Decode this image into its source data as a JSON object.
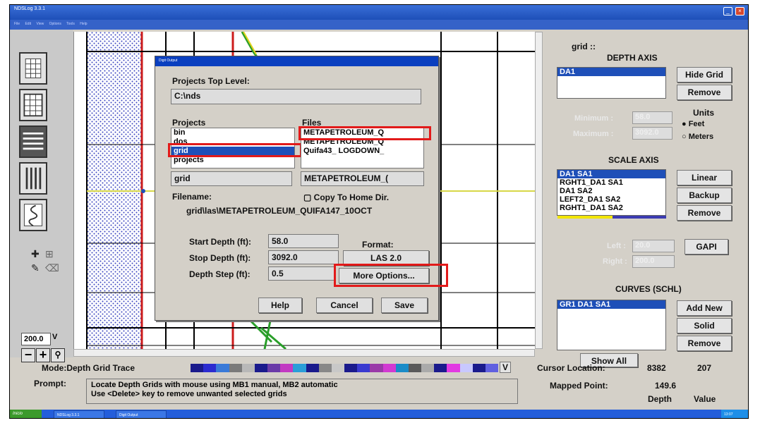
{
  "window": {
    "title": "NDSLog 3.3.1",
    "menu": [
      "File",
      "Edit",
      "View",
      "Options",
      "Tools",
      "Help"
    ]
  },
  "toolbar": {
    "zoom_value": "200.0",
    "zoom_dropdown": "V"
  },
  "dialog": {
    "title": "Digit Output",
    "projects_top_label": "Projects Top Level:",
    "projects_top_value": "C:\\nds",
    "projects_label": "Projects",
    "files_label": "Files",
    "projects_list": [
      "bin",
      "dos",
      "grid",
      "projects"
    ],
    "projects_selected": "grid",
    "files_list": [
      "METAPETROLEUM_Q",
      "METAPETROLEUM_Q",
      "Quifa43_ LOGDOWN_"
    ],
    "project_field": "grid",
    "file_field": "METAPETROLEUM_(",
    "filename_label": "Filename:",
    "copy_home": "Copy To Home Dir.",
    "filename_value": "grid\\las\\METAPETROLEUM_QUIFA147_10OCT",
    "start_depth_label": "Start Depth (ft):",
    "start_depth_value": "58.0",
    "stop_depth_label": "Stop Depth (ft):",
    "stop_depth_value": "3092.0",
    "depth_step_label": "Depth Step (ft):",
    "depth_step_value": "0.5",
    "format_label": "Format:",
    "format_value": "LAS 2.0",
    "more_options": "More Options...",
    "help": "Help",
    "cancel": "Cancel",
    "save": "Save"
  },
  "right_panel": {
    "grid_label": "grid ::",
    "depth_axis_title": "DEPTH AXIS",
    "depth_axis_items": [
      "DA1"
    ],
    "hide_grid": "Hide Grid",
    "remove1": "Remove",
    "units_label": "Units",
    "unit_feet": "Feet",
    "unit_meters": "Meters",
    "minimum_label": "Minimum :",
    "minimum_value": "58.0",
    "maximum_label": "Maximum :",
    "maximum_value": "3092.0",
    "scale_axis_title": "SCALE AXIS",
    "scale_axis_items": [
      "DA1 SA1",
      "RGHT1_DA1 SA1",
      "DA1 SA2",
      "LEFT2_DA1 SA2",
      "RGHT1_DA1 SA2"
    ],
    "linear": "Linear",
    "backup": "Backup",
    "remove2": "Remove",
    "left_label": "Left :",
    "left_value": "20.0",
    "right_label": "Right :",
    "right_value": "200.0",
    "gapi": "GAPI",
    "curves_title": "CURVES (SCHL)",
    "curves_items": [
      "GR1 DA1 SA1"
    ],
    "add_new": "Add New",
    "solid": "Solid",
    "remove3": "Remove",
    "show_all": "Show All"
  },
  "status": {
    "mode": "Mode:Depth Grid Trace",
    "colorbar_dropdown": "V",
    "prompt_label": "Prompt:",
    "prompt_line1": "Locate Depth Grids with mouse using MB1 manual, MB2 automatic",
    "prompt_line2": "Use <Delete> key to remove unwanted selected grids",
    "cursor_label": "Cursor Location:",
    "cursor_x": "8382",
    "cursor_y": "207",
    "mapped_label": "Mapped Point:",
    "mapped_value": "149.6",
    "depth_label": "Depth",
    "value_label": "Value"
  },
  "taskbar": {
    "start": "Inicio",
    "tasks": [
      "NDSLog 3.3.1",
      "Digit Output"
    ],
    "clock": "13:07"
  },
  "colors": {
    "selection": "#1e4fb8",
    "highlight_red": "#e21a1a",
    "grid_red": "#cc1b1b",
    "curve_green": "#2a9e2a"
  }
}
